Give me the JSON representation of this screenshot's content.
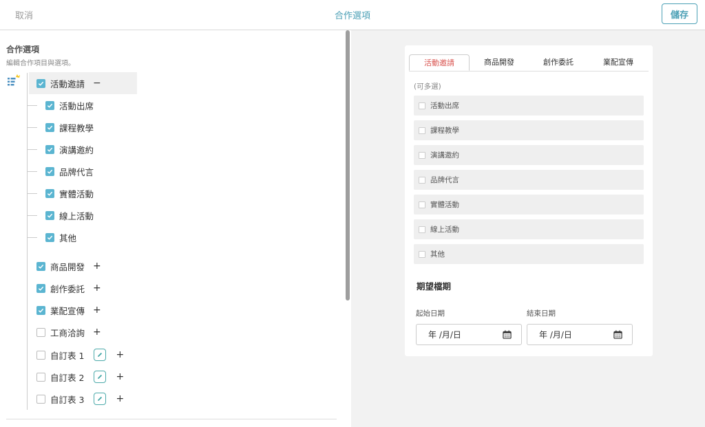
{
  "topbar": {
    "cancel": "取消",
    "title": "合作選項",
    "save": "儲存"
  },
  "editor": {
    "title": "合作選項",
    "subtitle": "編輯合作項目與選項。",
    "root": {
      "label": "活動邀請",
      "checked": true,
      "toggle": "−"
    },
    "children": [
      {
        "label": "活動出席",
        "checked": true
      },
      {
        "label": "課程教學",
        "checked": true
      },
      {
        "label": "演講邀約",
        "checked": true
      },
      {
        "label": "品牌代言",
        "checked": true
      },
      {
        "label": "實體活動",
        "checked": true
      },
      {
        "label": "線上活動",
        "checked": true
      },
      {
        "label": "其他",
        "checked": true
      }
    ],
    "groups": [
      {
        "label": "商品開發",
        "checked": true,
        "toggle": "+"
      },
      {
        "label": "創作委託",
        "checked": true,
        "toggle": "+"
      },
      {
        "label": "業配宣傳",
        "checked": true,
        "toggle": "+"
      },
      {
        "label": "工商洽詢",
        "checked": false,
        "toggle": "+"
      },
      {
        "label": "自訂表 1",
        "checked": false,
        "toggle": "+",
        "editable": true
      },
      {
        "label": "自訂表 2",
        "checked": false,
        "toggle": "+",
        "editable": true
      },
      {
        "label": "自訂表 3",
        "checked": false,
        "toggle": "+",
        "editable": true
      }
    ]
  },
  "preview": {
    "tabs": [
      "活動邀請",
      "商品開發",
      "創作委託",
      "業配宣傳"
    ],
    "active_tab": "活動邀請",
    "multi_note": "(可多選)",
    "options": [
      "活動出席",
      "課程教學",
      "演講邀約",
      "品牌代言",
      "實體活動",
      "線上活動",
      "其他"
    ],
    "period_title": "期望檔期",
    "start_label": "起始日期",
    "end_label": "結束日期",
    "start_value": "年 /月/日",
    "end_value": "年 /月/日"
  },
  "colors": {
    "accent": "#4a9fb5",
    "checkbox": "#5bb5d1",
    "active_tab_text": "#d9534f"
  }
}
